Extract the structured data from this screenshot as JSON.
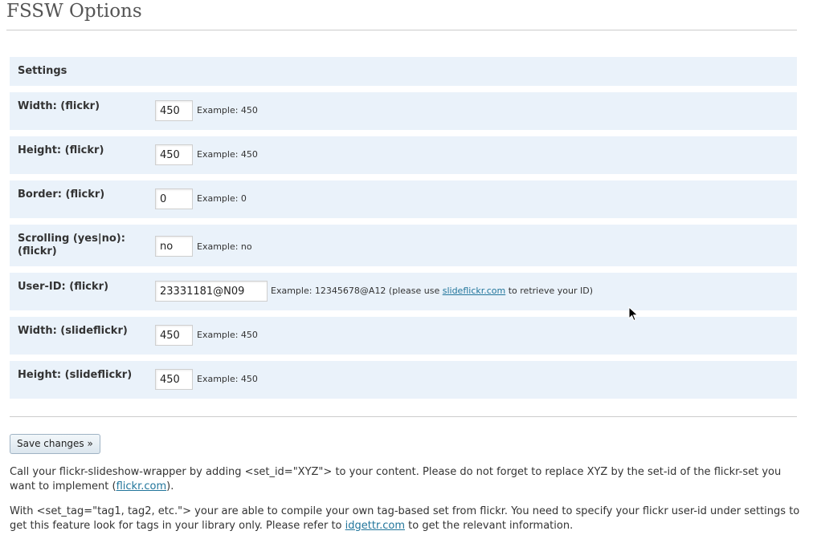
{
  "page": {
    "title": "FSSW Options"
  },
  "section": {
    "heading": "Settings"
  },
  "rows": [
    {
      "label": "Width: (flickr)",
      "value": "450",
      "hint": "Example: 450"
    },
    {
      "label": "Height: (flickr)",
      "value": "450",
      "hint": "Example: 450"
    },
    {
      "label": "Border: (flickr)",
      "value": "0",
      "hint": "Example: 0"
    },
    {
      "label_line1": "Scrolling (yes|no):",
      "label_line2": "(flickr)",
      "value": "no",
      "hint": "Example: no"
    },
    {
      "label": "User-ID: (flickr)",
      "value": "23331181@N09",
      "hint_before": "Example: 12345678@A12 (please use ",
      "hint_link": "slideflickr.com",
      "hint_after": " to retrieve your ID)"
    },
    {
      "label": "Width: (slideflickr)",
      "value": "450",
      "hint": "Example: 450"
    },
    {
      "label": "Height: (slideflickr)",
      "value": "450",
      "hint": "Example: 450"
    }
  ],
  "save_button": {
    "label": "Save changes »"
  },
  "info1": {
    "text": "Call your flickr-slideshow-wrapper by adding <set_id=\"XYZ\"> to your content. Please do not forget to replace XYZ by the set-id of the flickr-set you want to implement (",
    "link": "flickr.com",
    "after": ")."
  },
  "info2": {
    "text": "With <set_tag=\"tag1, tag2, etc.\"> your are able to compile your own tag-based set from flickr. You need to specify your flickr user-id under settings to get this feature look for tags in your library only. Please refer to ",
    "link": "idgettr.com",
    "after": " to get the relevant information."
  },
  "cursor": {
    "icon": "mouse-pointer-icon"
  }
}
